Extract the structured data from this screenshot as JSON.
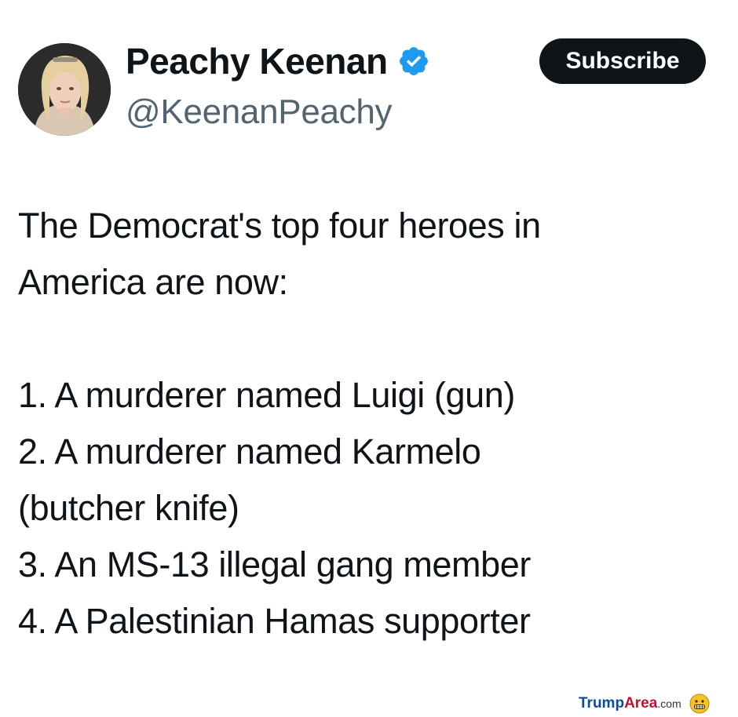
{
  "post": {
    "author": {
      "display_name": "Peachy Keenan",
      "handle": "@KeenanPeachy",
      "verified": true,
      "avatar_icon": "profile-photo"
    },
    "subscribe_label": "Subscribe",
    "text_lines": [
      "The Democrat's top four heroes in",
      "America are now:",
      "",
      "1. A murderer named Luigi (gun)",
      "2. A murderer named Karmelo",
      "(butcher knife)",
      "3. An MS-13 illegal gang member",
      "4. A Palestinian Hamas supporter"
    ]
  },
  "watermark": {
    "part1": "Trump",
    "part2": "Area",
    "part3": ".com",
    "icon": "grimacing-emoji-icon"
  },
  "colors": {
    "verified_badge": "#1d9bf0",
    "subscribe_bg": "#0f1419",
    "handle": "#536471",
    "text": "#0f1419"
  }
}
